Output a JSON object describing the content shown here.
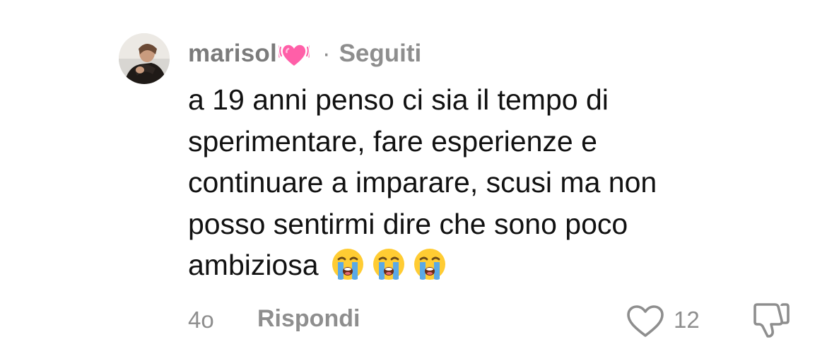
{
  "comment": {
    "username": "marisol",
    "username_emoji": "growing-heart-emoji",
    "separator": "·",
    "follow_status": "Seguiti",
    "text_lines": [
      "a 19 anni penso ci sia il tempo di",
      "sperimentare, fare esperienze e",
      "continuare a imparare, scusi ma non",
      "posso sentirmi dire che sono poco",
      "ambiziosa"
    ],
    "trailing_emojis": [
      "loudly-crying-face",
      "loudly-crying-face",
      "loudly-crying-face"
    ],
    "timestamp": "4o",
    "reply_label": "Rispondi",
    "like_count": "12",
    "icons": {
      "like": "heart-outline-icon",
      "dislike": "thumbs-down-outline-icon"
    },
    "colors": {
      "meta_gray": "#8e8e8e",
      "text": "#111111",
      "heart_pink": "#ff5fa8",
      "emoji_yellow": "#ffcc33",
      "tear_blue": "#5aa9e6"
    }
  }
}
